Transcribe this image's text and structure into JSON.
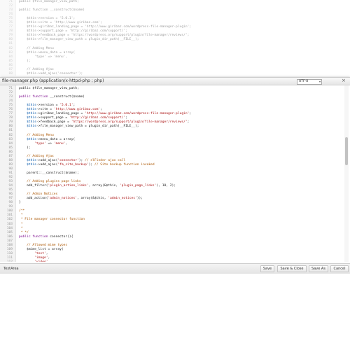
{
  "background_code": {
    "line_numbers": [
      "71",
      "72",
      "73",
      "74",
      "75",
      "76",
      "77",
      "78",
      "79",
      "80",
      "81",
      "82",
      "83",
      "84",
      "85",
      "86",
      "87",
      "88"
    ],
    "lines": [
      "public $file_manager_view_path;",
      "",
      "public function __construct($name)",
      "",
      "    $this->version = '5.0.1';",
      "    $this->site = 'http://www.giribaz.com';",
      "    $this->giribaz_landing_page = 'http://www.giribaz.com/wordpress-file-manager-plugin';",
      "    $this->support_page = 'http://giribaz.com/support/';",
      "    $this->feedback_page = 'https://wordpress.org/support/plugin/file-manager/reviews/';",
      "    $this->file_manager_view_path = plugin_dir_path(__FILE__);",
      "",
      "    // Adding Menu",
      "    $this->menu_data = array(",
      "        'type' => 'menu',",
      "    );",
      "",
      "    // Adding Ajax",
      "    $this->add_ajax('connector');"
    ]
  },
  "dialog": {
    "title": "file-manager.php (application/x-httpd-php ; php)",
    "encoding": "UTF-8",
    "close_label": "×",
    "mode": "TextArea",
    "buttons": {
      "save": "Save",
      "save_close": "Save & Close",
      "save_as": "Save As",
      "cancel": "Cancel"
    }
  },
  "editor": {
    "line_numbers": [
      "71",
      "72",
      "73",
      "74",
      "75",
      "76",
      "77",
      "78",
      "79",
      "80",
      "81",
      "82",
      "83",
      "84",
      "85",
      "86",
      "87",
      "88",
      "89",
      "90",
      "91",
      "92",
      "93",
      "94",
      "95",
      "96",
      "97",
      "98",
      "99",
      "100",
      "101",
      "102",
      "103",
      "104",
      "105",
      "106",
      "107",
      "108",
      "109",
      "110",
      "111",
      "112"
    ],
    "lines": [
      [
        {
          "t": "public $file_manager_view_path;",
          "c": "plain"
        }
      ],
      [
        {
          "t": "",
          "c": "plain"
        }
      ],
      [
        {
          "t": "public function ",
          "c": "kw"
        },
        {
          "t": "__construct($name)",
          "c": "plain"
        }
      ],
      [
        {
          "t": "",
          "c": "plain"
        }
      ],
      [
        {
          "t": "    $this",
          "c": "var"
        },
        {
          "t": "->version = ",
          "c": "plain"
        },
        {
          "t": "'5.0.1'",
          "c": "str"
        },
        {
          "t": ";",
          "c": "plain"
        }
      ],
      [
        {
          "t": "    $this",
          "c": "var"
        },
        {
          "t": "->site = ",
          "c": "plain"
        },
        {
          "t": "'http://www.giribaz.com'",
          "c": "str"
        },
        {
          "t": ";",
          "c": "plain"
        }
      ],
      [
        {
          "t": "    $this",
          "c": "var"
        },
        {
          "t": "->giribaz_landing_page = ",
          "c": "plain"
        },
        {
          "t": "'http://www.giribaz.com/wordpress-file-manager-plugin'",
          "c": "str"
        },
        {
          "t": ";",
          "c": "plain"
        }
      ],
      [
        {
          "t": "    $this",
          "c": "var"
        },
        {
          "t": "->support_page = ",
          "c": "plain"
        },
        {
          "t": "'http://giribaz.com/support/'",
          "c": "str"
        },
        {
          "t": ";",
          "c": "plain"
        }
      ],
      [
        {
          "t": "    $this",
          "c": "var"
        },
        {
          "t": "->feedback_page = ",
          "c": "plain"
        },
        {
          "t": "'https://wordpress.org/support/plugin/file-manager/reviews/'",
          "c": "str"
        },
        {
          "t": ";",
          "c": "plain"
        }
      ],
      [
        {
          "t": "    $this",
          "c": "var"
        },
        {
          "t": "->file_manager_view_path = plugin_dir_path(__FILE__);",
          "c": "plain"
        }
      ],
      [
        {
          "t": "",
          "c": "plain"
        }
      ],
      [
        {
          "t": "    // Adding Menu",
          "c": "cm"
        }
      ],
      [
        {
          "t": "    $this",
          "c": "var"
        },
        {
          "t": "->menu_data = array(",
          "c": "plain"
        }
      ],
      [
        {
          "t": "        'type'",
          "c": "str"
        },
        {
          "t": " => ",
          "c": "plain"
        },
        {
          "t": "'menu'",
          "c": "str"
        },
        {
          "t": ",",
          "c": "plain"
        }
      ],
      [
        {
          "t": "    );",
          "c": "plain"
        }
      ],
      [
        {
          "t": "",
          "c": "plain"
        }
      ],
      [
        {
          "t": "    // Adding Ajax",
          "c": "cm"
        }
      ],
      [
        {
          "t": "    $this",
          "c": "var"
        },
        {
          "t": "->add_ajax(",
          "c": "plain"
        },
        {
          "t": "'connector'",
          "c": "str"
        },
        {
          "t": "); ",
          "c": "plain"
        },
        {
          "t": "// elFinder ajax call",
          "c": "cm"
        }
      ],
      [
        {
          "t": "    $this",
          "c": "var"
        },
        {
          "t": "->add_ajax(",
          "c": "plain"
        },
        {
          "t": "'fm_site_backup'",
          "c": "str"
        },
        {
          "t": "); ",
          "c": "plain"
        },
        {
          "t": "// Site backup function invoked",
          "c": "cm"
        }
      ],
      [
        {
          "t": "",
          "c": "plain"
        }
      ],
      [
        {
          "t": "    parent::__construct($name);",
          "c": "plain"
        }
      ],
      [
        {
          "t": "",
          "c": "plain"
        }
      ],
      [
        {
          "t": "    // Adding plugins page links",
          "c": "cm"
        }
      ],
      [
        {
          "t": "    add_filter(",
          "c": "plain"
        },
        {
          "t": "'plugin_action_links'",
          "c": "str"
        },
        {
          "t": ", array(&$this, ",
          "c": "plain"
        },
        {
          "t": "'plugin_page_links'",
          "c": "str"
        },
        {
          "t": "), 10, 2);",
          "c": "plain"
        }
      ],
      [
        {
          "t": "",
          "c": "plain"
        }
      ],
      [
        {
          "t": "    // Admin Notices",
          "c": "cm"
        }
      ],
      [
        {
          "t": "    add_action(",
          "c": "plain"
        },
        {
          "t": "'admin_notices'",
          "c": "str"
        },
        {
          "t": ", array(&$this, ",
          "c": "plain"
        },
        {
          "t": "'admin_notices'",
          "c": "str"
        },
        {
          "t": "));",
          "c": "plain"
        }
      ],
      [
        {
          "t": "}",
          "c": "plain"
        }
      ],
      [
        {
          "t": "",
          "c": "plain"
        }
      ],
      [
        {
          "t": "/**",
          "c": "cm"
        }
      ],
      [
        {
          "t": " *",
          "c": "cm"
        }
      ],
      [
        {
          "t": " * File manager connector function",
          "c": "cm"
        }
      ],
      [
        {
          "t": " *",
          "c": "cm"
        }
      ],
      [
        {
          "t": " * ",
          "c": "cm"
        }
      ],
      [
        {
          "t": " * */",
          "c": "cm"
        }
      ],
      [
        {
          "t": "public function ",
          "c": "kw"
        },
        {
          "t": "connector(){",
          "c": "plain"
        }
      ],
      [
        {
          "t": "",
          "c": "plain"
        }
      ],
      [
        {
          "t": "    // Allowed mime types",
          "c": "cm"
        }
      ],
      [
        {
          "t": "    $mime_list = array(",
          "c": "plain"
        }
      ],
      [
        {
          "t": "        'text'",
          "c": "str"
        },
        {
          "t": ",",
          "c": "plain"
        }
      ],
      [
        {
          "t": "        'image'",
          "c": "str"
        },
        {
          "t": ",",
          "c": "plain"
        }
      ],
      [
        {
          "t": "        'video'",
          "c": "str"
        },
        {
          "t": ",",
          "c": "plain"
        }
      ]
    ]
  },
  "scroll": {
    "position": 0.35
  }
}
